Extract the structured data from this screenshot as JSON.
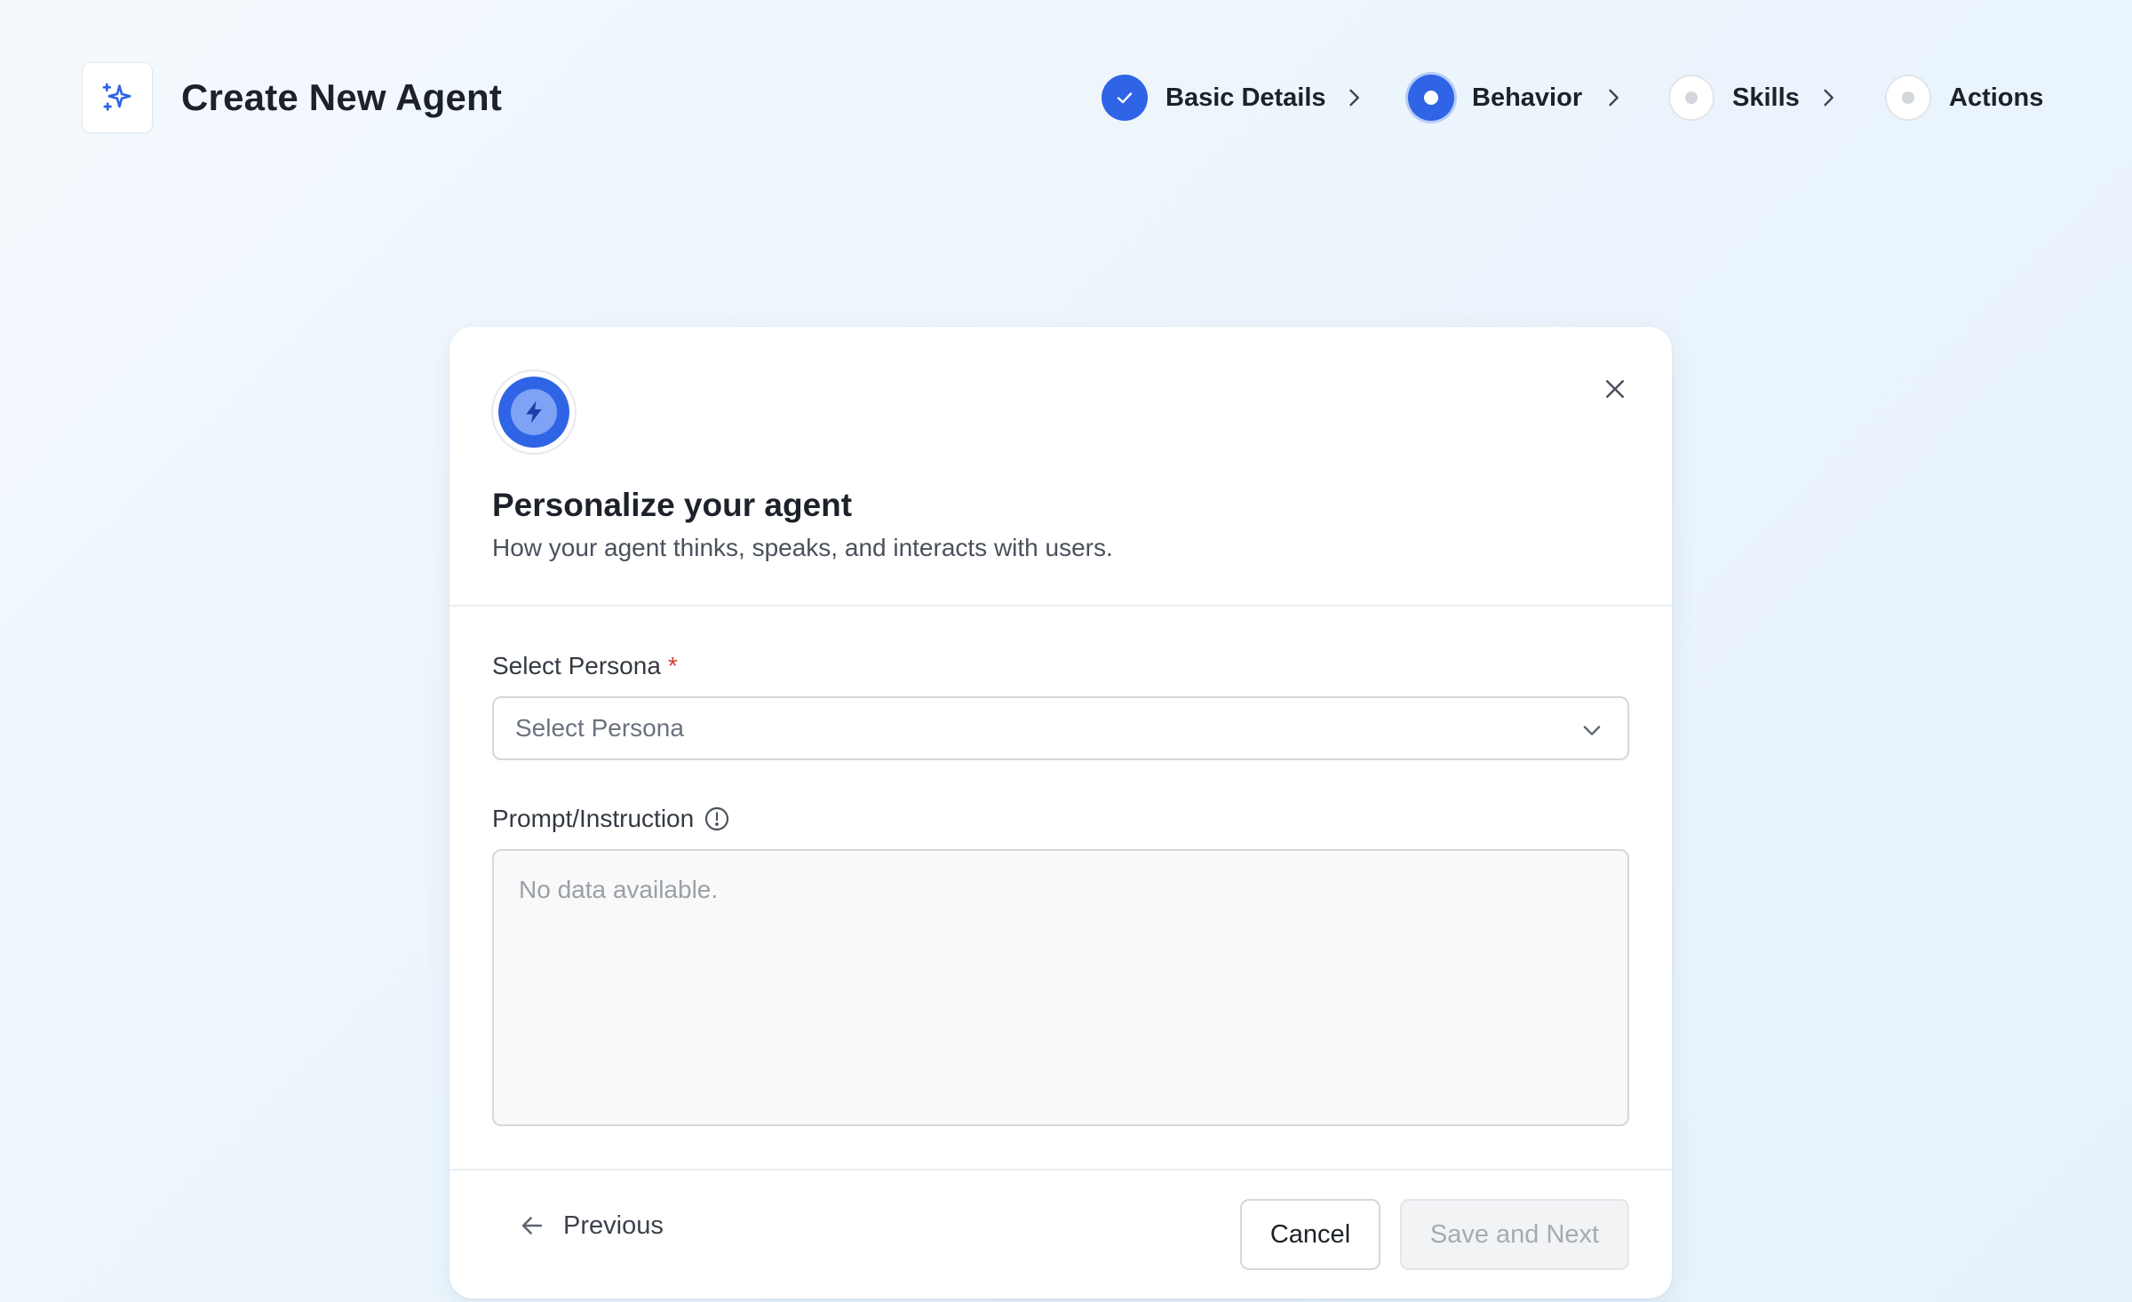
{
  "header": {
    "title": "Create New Agent",
    "logo_icon": "sparkles-icon"
  },
  "stepper": {
    "accent_color": "#2f64e6",
    "steps": [
      {
        "label": "Basic Details",
        "status": "completed",
        "icon": "check-icon"
      },
      {
        "label": "Behavior",
        "status": "current",
        "icon": "dot-icon"
      },
      {
        "label": "Skills",
        "status": "pending",
        "icon": "dot-icon"
      },
      {
        "label": "Actions",
        "status": "pending",
        "icon": "dot-icon"
      }
    ]
  },
  "modal": {
    "icon": "lightning-icon",
    "title": "Personalize your agent",
    "subtitle": "How your agent thinks, speaks, and interacts with users.",
    "persona": {
      "label": "Select Persona",
      "required_marker": "*",
      "placeholder": "Select Persona"
    },
    "prompt": {
      "label": "Prompt/Instruction",
      "info_icon": "info-icon",
      "placeholder": "No data available."
    },
    "footer": {
      "previous_label": "Previous",
      "cancel_label": "Cancel",
      "save_label": "Save and Next"
    }
  }
}
